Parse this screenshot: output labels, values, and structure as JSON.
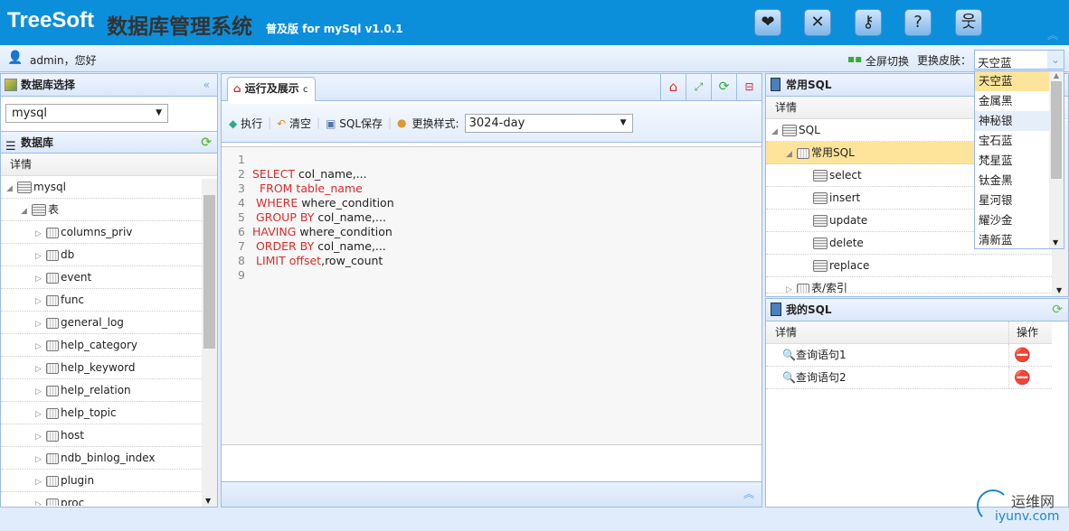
{
  "header": {
    "brand": "TreeSoft",
    "title": "数据库管理系统",
    "edition": "普及版 for mySql v1.0.1",
    "icons": [
      "heart-icon",
      "tools-icon",
      "key-icon",
      "help-icon",
      "user-run-icon"
    ]
  },
  "userbar": {
    "greeting": "admin，您好",
    "fullscreen": "全屏切换",
    "skin_label": "更换皮肤：",
    "skin_value": "天空蓝",
    "skin_options": [
      "天空蓝",
      "金属黑",
      "神秘银",
      "宝石蓝",
      "梵星蓝",
      "钛金黑",
      "星河银",
      "耀沙金",
      "清新蓝"
    ]
  },
  "left": {
    "db_select_title": "数据库选择",
    "db_value": "mysql",
    "db_title": "数据库",
    "col": "详情",
    "root": "mysql",
    "group": "表",
    "tables": [
      "columns_priv",
      "db",
      "event",
      "func",
      "general_log",
      "help_category",
      "help_keyword",
      "help_relation",
      "help_topic",
      "host",
      "ndb_binlog_index",
      "plugin",
      "proc"
    ]
  },
  "center": {
    "tab": "运行及展示",
    "toolbar": {
      "run": "执行",
      "clear": "清空",
      "save": "SQL保存",
      "style_label": "更换样式:",
      "style_value": "3024-day"
    },
    "code": [
      {
        "n": "1",
        "seg": []
      },
      {
        "n": "2",
        "seg": [
          {
            "t": "SELECT ",
            "k": 1
          },
          {
            "t": "col_name,...",
            "k": 0
          }
        ]
      },
      {
        "n": "3",
        "seg": [
          {
            "t": "  FROM table_name",
            "k": 1
          }
        ]
      },
      {
        "n": "4",
        "seg": [
          {
            "t": " WHERE ",
            "k": 1
          },
          {
            "t": "where_condition",
            "k": 0
          }
        ]
      },
      {
        "n": "5",
        "seg": [
          {
            "t": " GROUP BY ",
            "k": 1
          },
          {
            "t": "col_name,...",
            "k": 0
          }
        ]
      },
      {
        "n": "6",
        "seg": [
          {
            "t": "HAVING ",
            "k": 1
          },
          {
            "t": "where_condition",
            "k": 0
          }
        ]
      },
      {
        "n": "7",
        "seg": [
          {
            "t": " ORDER BY ",
            "k": 1
          },
          {
            "t": "col_name,...",
            "k": 0
          }
        ]
      },
      {
        "n": "8",
        "seg": [
          {
            "t": " LIMIT ",
            "k": 1
          },
          {
            "t": "offset",
            "k": 1
          },
          {
            "t": ",row_count",
            "k": 0
          }
        ]
      },
      {
        "n": "9",
        "seg": []
      }
    ]
  },
  "right": {
    "common_title": "常用SQL",
    "col": "详情",
    "root": "SQL",
    "group": "常用SQL",
    "items": [
      "select",
      "insert",
      "update",
      "delete",
      "replace"
    ],
    "tables": "表/索引",
    "my_title": "我的SQL",
    "my_cols": [
      "详情",
      "操作"
    ],
    "my_items": [
      "查询语句1",
      "查询语句2"
    ]
  },
  "watermark": {
    "text": "运维网",
    "url": "iyunv.com"
  }
}
